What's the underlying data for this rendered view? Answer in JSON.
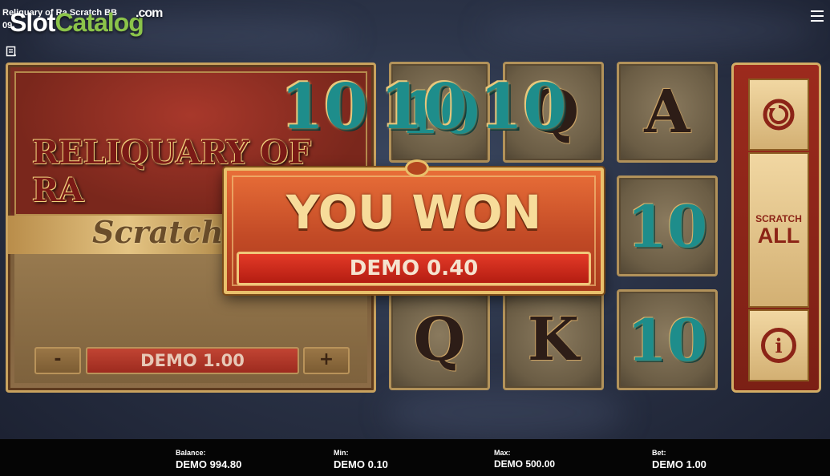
{
  "header": {
    "game_title": "Reliquary of Ra Scratch BB",
    "time": "09",
    "watermark_slot": "Slot",
    "watermark_catalog": "Catalog",
    "watermark_com": ".com"
  },
  "card": {
    "logo_text": "RELIQUARY OF RA",
    "subtitle": "Scratch",
    "minus_label": "-",
    "plus_label": "+",
    "bet_value": "DEMO 1.00"
  },
  "floating_symbols": [
    "10",
    "10",
    "10"
  ],
  "grid": {
    "tiles": [
      {
        "symbol": "10",
        "style": "teal"
      },
      {
        "symbol": "Q",
        "style": "dark"
      },
      {
        "symbol": "A",
        "style": "dark"
      },
      {
        "symbol": "10",
        "style": "teal"
      },
      {
        "symbol": "Q",
        "style": "dark"
      },
      {
        "symbol": "K",
        "style": "dark"
      },
      {
        "symbol": "10",
        "style": "teal"
      }
    ]
  },
  "side_panel": {
    "scratch_all_line1": "SCRATCH",
    "scratch_all_line2": "ALL",
    "info_label": "i",
    "refresh_icon": "refresh-icon"
  },
  "win": {
    "title": "YOU WON",
    "amount": "DEMO 0.40"
  },
  "footer": {
    "balance_label": "Balance:",
    "balance_value": "DEMO 994.80",
    "min_label": "Min:",
    "min_value": "DEMO 0.10",
    "max_label": "Max:",
    "max_value": "DEMO 500.00",
    "bet_label": "Bet:",
    "bet_value": "DEMO 1.00"
  },
  "colors": {
    "accent_gold": "#d3ad65",
    "win_red": "#c24a26",
    "teal_symbol": "#1e8d8b",
    "watermark_green": "#8bc34a"
  }
}
